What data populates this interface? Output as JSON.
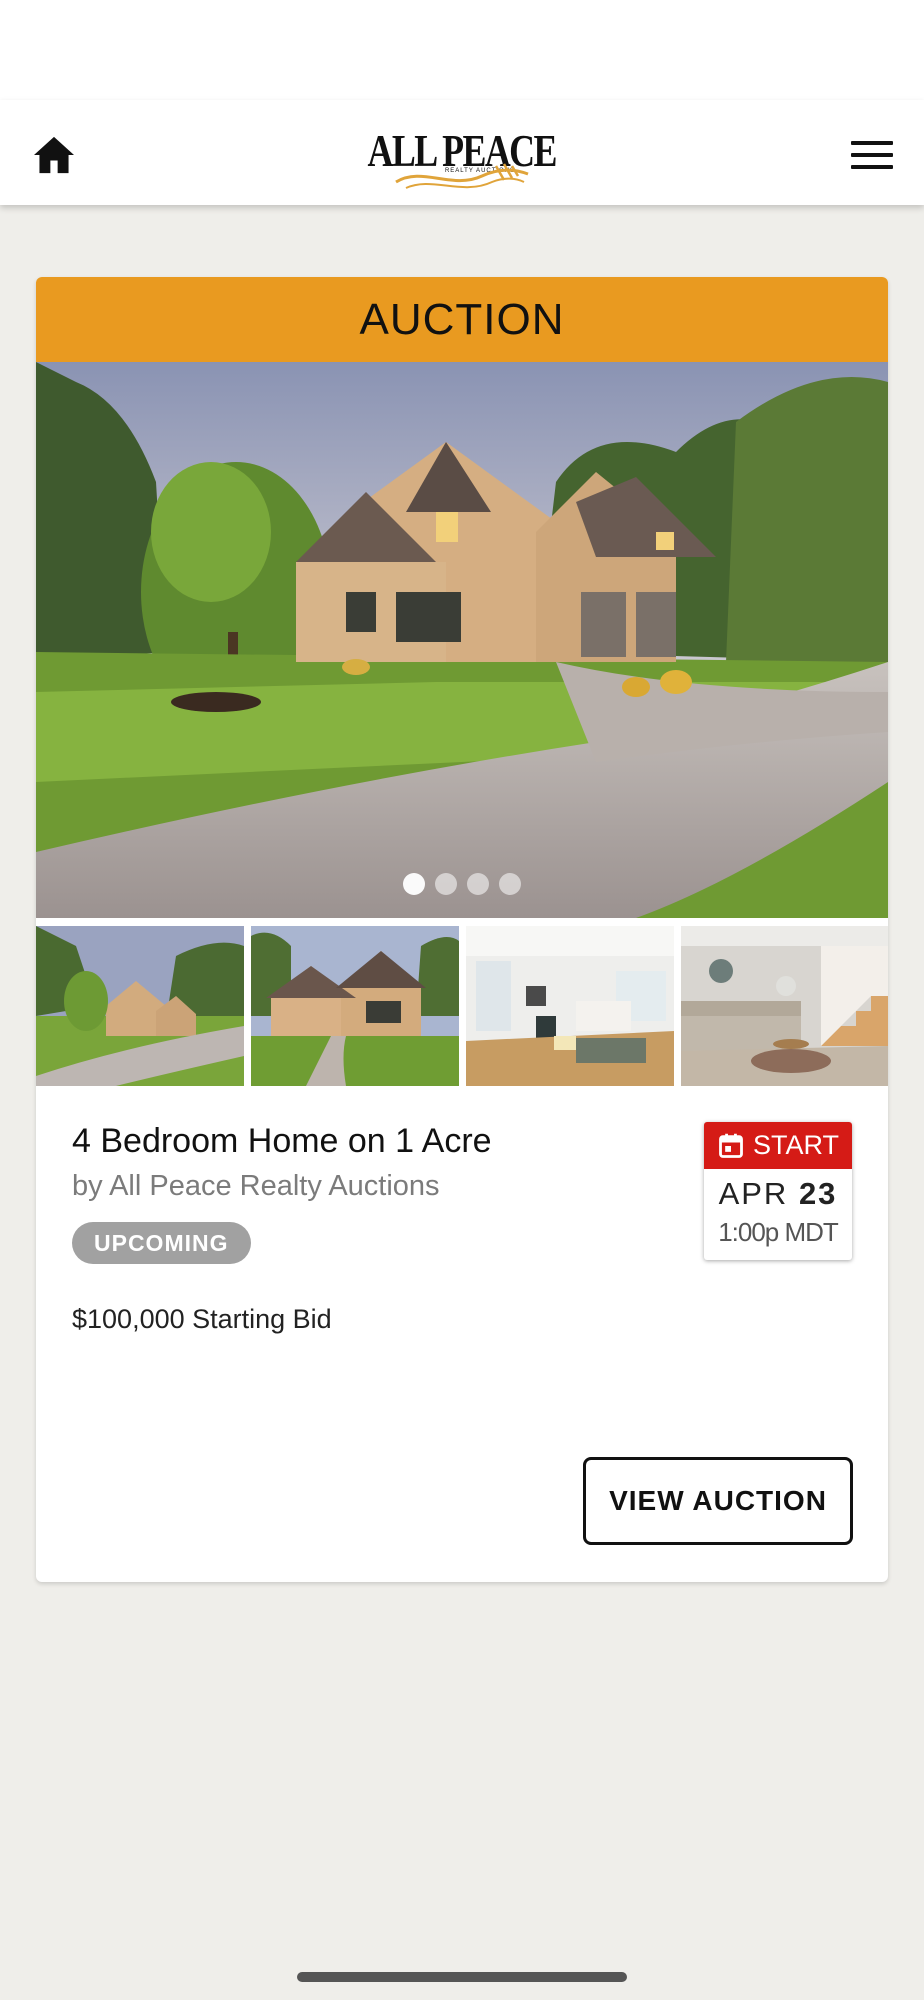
{
  "header": {
    "logo_text": "ALL PEACE",
    "logo_subtext": "REALTY AUCTIONS",
    "home_icon": "home-icon",
    "menu_icon": "hamburger-menu-icon"
  },
  "listing": {
    "type_label": "AUCTION",
    "title": "4 Bedroom Home on 1 Acre",
    "byline": "by All Peace Realty Auctions",
    "status_badge": "UPCOMING",
    "price_text": "$100,000 Starting Bid",
    "carousel": {
      "total_images": 4,
      "active_index": 0
    },
    "thumbnails": [
      "house-exterior-wide",
      "house-front-walkway",
      "living-room-white",
      "living-room-staircase"
    ],
    "start": {
      "label": "START",
      "month": "APR",
      "day": "23",
      "time": "1:00p MDT",
      "icon": "calendar-icon"
    },
    "cta_label": "VIEW AUCTION"
  },
  "colors": {
    "header_orange": "#e99a20",
    "start_red": "#d51b16",
    "badge_gray": "#a1a1a1",
    "page_bg": "#efeeea"
  }
}
